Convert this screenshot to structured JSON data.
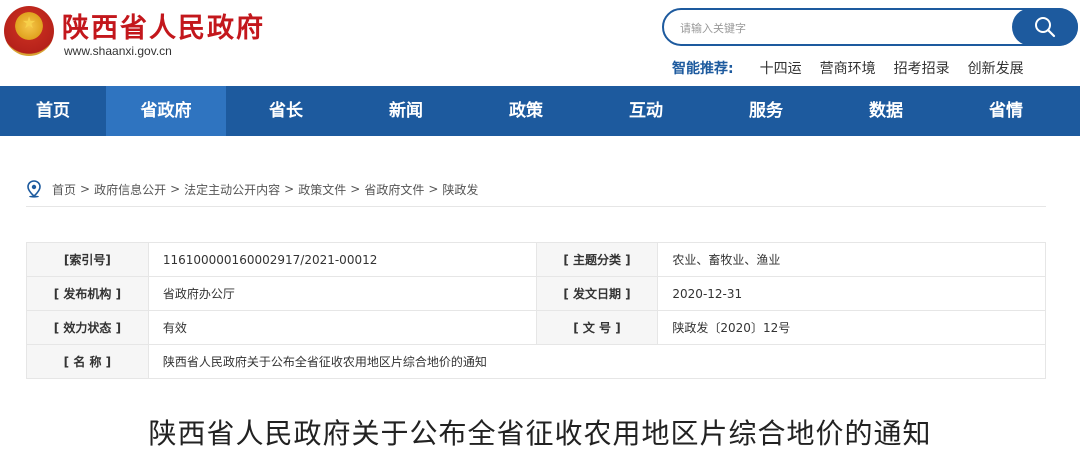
{
  "header": {
    "site_title": "陕西省人民政府",
    "site_url": "www.shaanxi.gov.cn",
    "search_placeholder": "请输入关键字",
    "hot_label": "智能推荐:",
    "hot_items": [
      "十四运",
      "营商环境",
      "招考招录",
      "创新发展"
    ]
  },
  "nav": {
    "items": [
      "首页",
      "省政府",
      "省长",
      "新闻",
      "政策",
      "互动",
      "服务",
      "数据",
      "省情"
    ],
    "active_index": 1
  },
  "breadcrumb": {
    "items": [
      "首页",
      "政府信息公开",
      "法定主动公开内容",
      "政策文件",
      "省政府文件",
      "陕政发"
    ],
    "separator": ">"
  },
  "info": {
    "index_label": "[索引号]",
    "index_value": "116100000160002917/2021-00012",
    "topic_label": "[ 主题分类 ]",
    "topic_value": "农业、畜牧业、渔业",
    "publisher_label": "[ 发布机构 ]",
    "publisher_value": "省政府办公厅",
    "date_label": "[ 发文日期 ]",
    "date_value": "2020-12-31",
    "status_label": "[ 效力状态 ]",
    "status_value": "有效",
    "number_label": "[ 文 号 ]",
    "number_value": "陕政发〔2020〕12号",
    "name_label": "[ 名 称 ]",
    "name_value": "陕西省人民政府关于公布全省征收农用地区片综合地价的通知"
  },
  "document": {
    "title": "陕西省人民政府关于公布全省征收农用地区片综合地价的通知"
  },
  "colors": {
    "brand_red": "#c3171c",
    "nav_blue": "#1d5a9e",
    "nav_active": "#2f74c0"
  }
}
